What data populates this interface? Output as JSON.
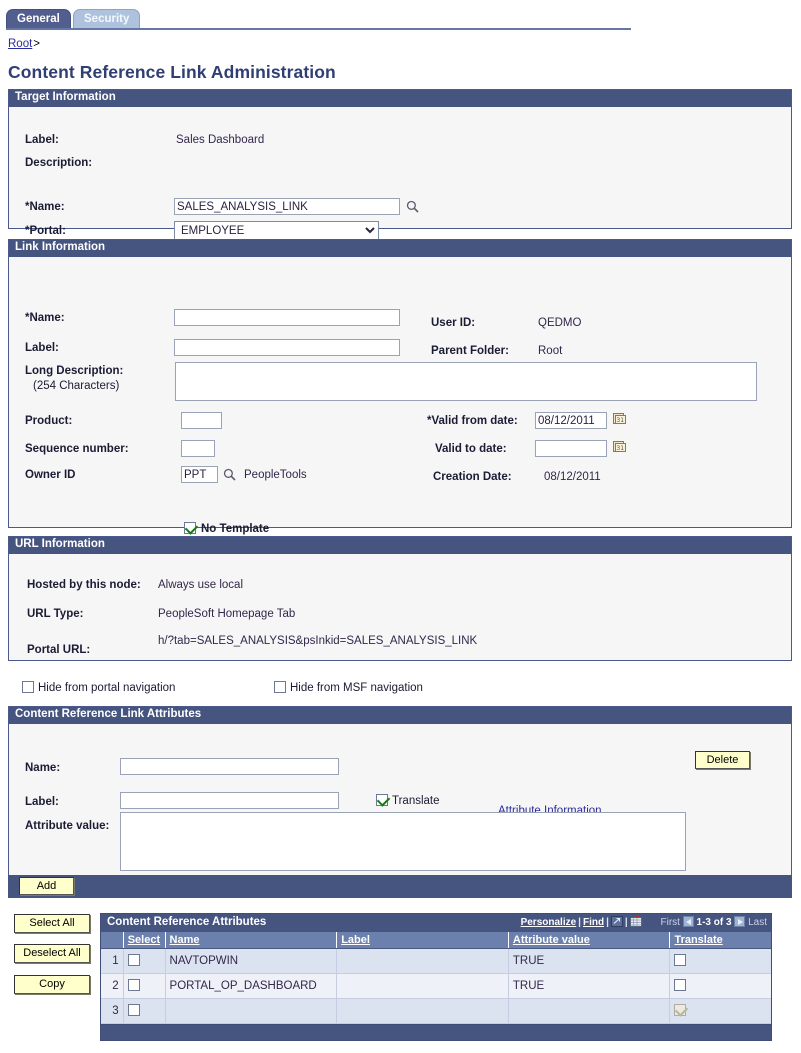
{
  "tabs": [
    {
      "label": "General",
      "selected": true
    },
    {
      "label": "Security",
      "selected": false
    }
  ],
  "breadcrumb": {
    "root": "Root",
    "separator": ">"
  },
  "page_title": "Content Reference Link Administration",
  "target_information": {
    "header": "Target Information",
    "label_caption": "Label:",
    "label_value": "Sales Dashboard",
    "description_caption": "Description:",
    "description_value": "",
    "name_caption": "*Name:",
    "name_value": "SALES_ANALYSIS_LINK",
    "name_lookup_icon": "magnifier-icon",
    "portal_caption": "*Portal:",
    "portal_value": "EMPLOYEE",
    "portal_options": [
      "EMPLOYEE"
    ]
  },
  "link_information": {
    "header": "Link Information",
    "name_caption": "*Name:",
    "name_value": "",
    "label_caption": "Label:",
    "label_value": "",
    "long_description_caption": "Long Description:",
    "long_description_sub": "(254 Characters)",
    "long_description_value": "",
    "product_caption": "Product:",
    "product_value": "",
    "sequence_caption": "Sequence number:",
    "sequence_value": "",
    "owner_id_caption": "Owner ID",
    "owner_id_value": "PPT",
    "owner_id_lookup_icon": "magnifier-icon",
    "owner_id_desc": "PeopleTools",
    "user_id_caption": "User ID:",
    "user_id_value": "QEDMO",
    "parent_folder_caption": "Parent Folder:",
    "parent_folder_value": "Root",
    "valid_from_caption": "*Valid from date:",
    "valid_from_value": "08/12/2011",
    "valid_to_caption": "Valid to date:",
    "valid_to_value": "",
    "creation_date_caption": "Creation Date:",
    "creation_date_value": "08/12/2011",
    "calendar_icon": "calendar-icon",
    "no_template_label": "No Template",
    "no_template_checked": true
  },
  "url_information": {
    "header": "URL Information",
    "hosted_caption": "Hosted by this node:",
    "hosted_value": "Always use local",
    "url_type_caption": "URL Type:",
    "url_type_value": "PeopleSoft Homepage Tab",
    "portal_url_caption": "Portal URL:",
    "portal_url_value": "h/?tab=SALES_ANALYSIS&psInkid=SALES_ANALYSIS_LINK"
  },
  "nav_checkboxes": {
    "hide_portal_label": "Hide from portal navigation",
    "hide_portal_checked": false,
    "hide_msf_label": "Hide from MSF navigation",
    "hide_msf_checked": false
  },
  "cref_link_attributes": {
    "header": "Content Reference Link Attributes",
    "name_caption": "Name:",
    "name_value": "",
    "label_caption": "Label:",
    "label_value": "",
    "translate_label": "Translate",
    "translate_checked": true,
    "attribute_information_link": "Attribute Information",
    "attribute_value_caption": "Attribute value:",
    "attribute_value": "",
    "delete_button": "Delete",
    "add_button": "Add"
  },
  "side_buttons": {
    "select_all": "Select All",
    "deselect_all": "Deselect All",
    "copy": "Copy"
  },
  "cref_attributes_grid": {
    "title": "Content Reference Attributes",
    "personalize_link": "Personalize",
    "find_link": "Find",
    "view_all_icon": "expand-grid-icon",
    "download_icon": "download-spreadsheet-icon",
    "first_label": "First",
    "prev_icon": "previous-page-icon",
    "counter": "1-3 of 3",
    "next_icon": "next-page-icon",
    "last_label": "Last",
    "columns": [
      "Select",
      "Name",
      "Label",
      "Attribute value",
      "Translate"
    ],
    "rows": [
      {
        "num": "1",
        "select": false,
        "name": "NAVTOPWIN",
        "label": "",
        "attribute_value": "TRUE",
        "translate": false,
        "translate_disabled": false
      },
      {
        "num": "2",
        "select": false,
        "name": "PORTAL_OP_DASHBOARD",
        "label": "",
        "attribute_value": "TRUE",
        "translate": false,
        "translate_disabled": false
      },
      {
        "num": "3",
        "select": false,
        "name": "",
        "label": "",
        "attribute_value": "",
        "translate": true,
        "translate_disabled": true
      }
    ]
  },
  "colors": {
    "header_blue": "#465480",
    "tab_selected": "#525f8e",
    "tab_unselected": "#aec2dd",
    "title_blue": "#2f3f73",
    "button_yellow": "#ffffcc",
    "link_blue": "#2c2c9e",
    "grid_col_header": "#6c80ad",
    "row_odd": "#dbe3f0",
    "row_even": "#eef1f8"
  }
}
